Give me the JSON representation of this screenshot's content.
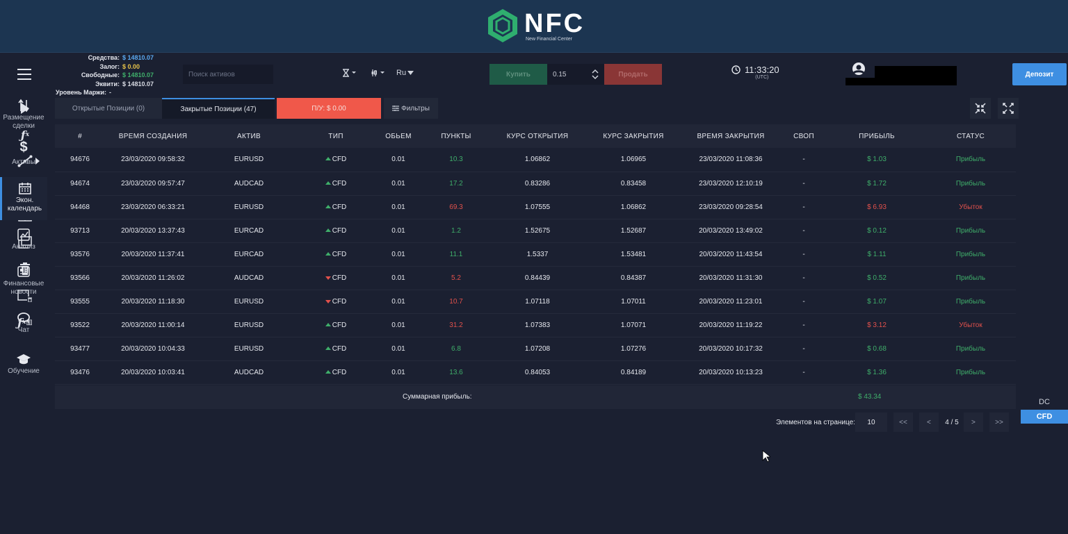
{
  "header": {
    "logo_text": "NFC",
    "logo_sub": "New Financial Center"
  },
  "account": {
    "funds_label": "Средства:",
    "funds_value": "$ 14810.07",
    "margin_label": "Залог:",
    "margin_value": "$ 0.00",
    "free_label": "Свободные:",
    "free_value": "$ 14810.07",
    "equity_label": "Эквити:",
    "equity_value": "$ 14810.07",
    "margin_level_label": "Уровень Маржи:",
    "margin_level_value": "-"
  },
  "search": {
    "placeholder": "Поиск активов"
  },
  "toolbar": {
    "language": "Ru",
    "buy_label": "Купить",
    "quantity": "0.15",
    "sell_label": "Продать",
    "time": "11:33:20",
    "timezone": "(UTC)",
    "deposit_label": "Депозит"
  },
  "tabs": {
    "open_label": "Открытые Позиции (0)",
    "closed_label": "Закрытые Позиции (47)",
    "pl_label": "П/У: $ 0.00",
    "filter_label": "Фильтры"
  },
  "table": {
    "headers": [
      "#",
      "ВРЕМЯ СОЗДАНИЯ",
      "АКТИВ",
      "ТИП",
      "ОБЬЕМ",
      "ПУНКТЫ",
      "КУРС ОТКРЫТИЯ",
      "КУРС ЗАКРЫТИЯ",
      "ВРЕМЯ ЗАКРЫТИЯ",
      "СВОП",
      "ПРИБЫЛЬ",
      "СТАТУС"
    ],
    "rows": [
      {
        "id": "94676",
        "created": "23/03/2020 09:58:32",
        "asset": "EURUSD",
        "dir": "up",
        "type": "CFD",
        "volume": "0.01",
        "points": "10.3",
        "points_pos": true,
        "open": "1.06862",
        "close": "1.06965",
        "closed": "23/03/2020 11:08:36",
        "swap": "-",
        "profit": "$ 1.03",
        "profit_pos": true,
        "status": "Прибыль"
      },
      {
        "id": "94674",
        "created": "23/03/2020 09:57:47",
        "asset": "AUDCAD",
        "dir": "up",
        "type": "CFD",
        "volume": "0.01",
        "points": "17.2",
        "points_pos": true,
        "open": "0.83286",
        "close": "0.83458",
        "closed": "23/03/2020 12:10:19",
        "swap": "-",
        "profit": "$ 1.72",
        "profit_pos": true,
        "status": "Прибыль"
      },
      {
        "id": "94468",
        "created": "23/03/2020 06:33:21",
        "asset": "EURUSD",
        "dir": "up",
        "type": "CFD",
        "volume": "0.01",
        "points": "69.3",
        "points_pos": false,
        "open": "1.07555",
        "close": "1.06862",
        "closed": "23/03/2020 09:28:54",
        "swap": "-",
        "profit": "$ 6.93",
        "profit_pos": false,
        "status": "Убыток"
      },
      {
        "id": "93713",
        "created": "20/03/2020 13:37:43",
        "asset": "EURCAD",
        "dir": "up",
        "type": "CFD",
        "volume": "0.01",
        "points": "1.2",
        "points_pos": true,
        "open": "1.52675",
        "close": "1.52687",
        "closed": "20/03/2020 13:49:02",
        "swap": "-",
        "profit": "$ 0.12",
        "profit_pos": true,
        "status": "Прибыль"
      },
      {
        "id": "93576",
        "created": "20/03/2020 11:37:41",
        "asset": "EURCAD",
        "dir": "up",
        "type": "CFD",
        "volume": "0.01",
        "points": "11.1",
        "points_pos": true,
        "open": "1.5337",
        "close": "1.53481",
        "closed": "20/03/2020 11:43:54",
        "swap": "-",
        "profit": "$ 1.11",
        "profit_pos": true,
        "status": "Прибыль"
      },
      {
        "id": "93566",
        "created": "20/03/2020 11:26:02",
        "asset": "AUDCAD",
        "dir": "down",
        "type": "CFD",
        "volume": "0.01",
        "points": "5.2",
        "points_pos": false,
        "open": "0.84439",
        "close": "0.84387",
        "closed": "20/03/2020 11:31:30",
        "swap": "-",
        "profit": "$ 0.52",
        "profit_pos": true,
        "status": "Прибыль"
      },
      {
        "id": "93555",
        "created": "20/03/2020 11:18:30",
        "asset": "EURUSD",
        "dir": "down",
        "type": "CFD",
        "volume": "0.01",
        "points": "10.7",
        "points_pos": false,
        "open": "1.07118",
        "close": "1.07011",
        "closed": "20/03/2020 11:23:01",
        "swap": "-",
        "profit": "$ 1.07",
        "profit_pos": true,
        "status": "Прибыль"
      },
      {
        "id": "93522",
        "created": "20/03/2020 11:00:14",
        "asset": "EURUSD",
        "dir": "up",
        "type": "CFD",
        "volume": "0.01",
        "points": "31.2",
        "points_pos": false,
        "open": "1.07383",
        "close": "1.07071",
        "closed": "20/03/2020 11:19:22",
        "swap": "-",
        "profit": "$ 3.12",
        "profit_pos": false,
        "status": "Убыток"
      },
      {
        "id": "93477",
        "created": "20/03/2020 10:04:33",
        "asset": "EURUSD",
        "dir": "up",
        "type": "CFD",
        "volume": "0.01",
        "points": "6.8",
        "points_pos": true,
        "open": "1.07208",
        "close": "1.07276",
        "closed": "20/03/2020 10:17:32",
        "swap": "-",
        "profit": "$ 0.68",
        "profit_pos": true,
        "status": "Прибыль"
      },
      {
        "id": "93476",
        "created": "20/03/2020 10:03:41",
        "asset": "AUDCAD",
        "dir": "up",
        "type": "CFD",
        "volume": "0.01",
        "points": "13.6",
        "points_pos": true,
        "open": "0.84053",
        "close": "0.84189",
        "closed": "20/03/2020 10:13:23",
        "swap": "-",
        "profit": "$ 1.36",
        "profit_pos": true,
        "status": "Прибыль"
      }
    ],
    "total_label": "Суммарная прибыль:",
    "total_value": "$ 43.34"
  },
  "pager": {
    "per_page_label": "Элементов на странице:",
    "per_page": "10",
    "first": "<<",
    "prev": "<",
    "page": "4 / 5",
    "next": ">",
    "last": ">>"
  },
  "right_bar": {
    "place_order": "Размещение сделки",
    "assets": "Активы",
    "calendar": "Экон. календарь",
    "analysis": "Анализ",
    "news": "Финансовые новости",
    "chat": "Чат",
    "learning": "Обучение",
    "dc": "DC",
    "cfd": "CFD"
  },
  "colors": {
    "header_bg": "#1c3551",
    "page_bg": "#1b2031",
    "accent_blue": "#3e8fe2",
    "profit_green": "#3fae6a",
    "loss_red": "#e2514c",
    "pl_tab": "#f0584a",
    "funds_value": "#5aa8ef",
    "margin_value": "#e5c14a",
    "free_value": "#3fae6a"
  }
}
